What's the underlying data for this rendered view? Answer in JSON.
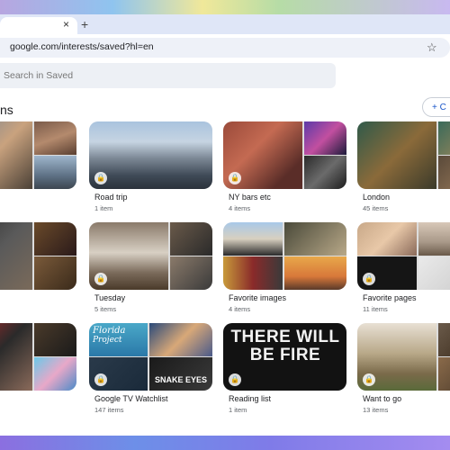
{
  "browser": {
    "new_tab_label": "+",
    "tab_close_label": "×",
    "url": "google.com/interests/saved?hl=en",
    "star_icon": "star-icon"
  },
  "page": {
    "search_placeholder": "Search in Saved",
    "heading": "ns",
    "create_label": "+ C"
  },
  "collections": [
    {
      "title": "ms",
      "count": ""
    },
    {
      "title": "Road trip",
      "count": "1 item"
    },
    {
      "title": "NY bars etc",
      "count": "4 items"
    },
    {
      "title": "London",
      "count": "45 items"
    },
    {
      "title": "",
      "count": ""
    },
    {
      "title": "Tuesday",
      "count": "5 items"
    },
    {
      "title": "Favorite images",
      "count": "4 items"
    },
    {
      "title": "Favorite pages",
      "count": "11 items"
    },
    {
      "title": "atchlist",
      "count": ""
    },
    {
      "title": "Google TV Watchlist",
      "count": "147 items",
      "poster_a": "Florida",
      "poster_b": "Project",
      "poster_c": "SNAKE EYES"
    },
    {
      "title": "Reading list",
      "count": "1 item",
      "cover_text": "THERE WILL BE FIRE"
    },
    {
      "title": "Want to go",
      "count": "13 items"
    }
  ],
  "colors": {
    "accent": "#1a56c9",
    "tab_strip": "#dfe6f7",
    "search_bg": "#edf0f5"
  }
}
